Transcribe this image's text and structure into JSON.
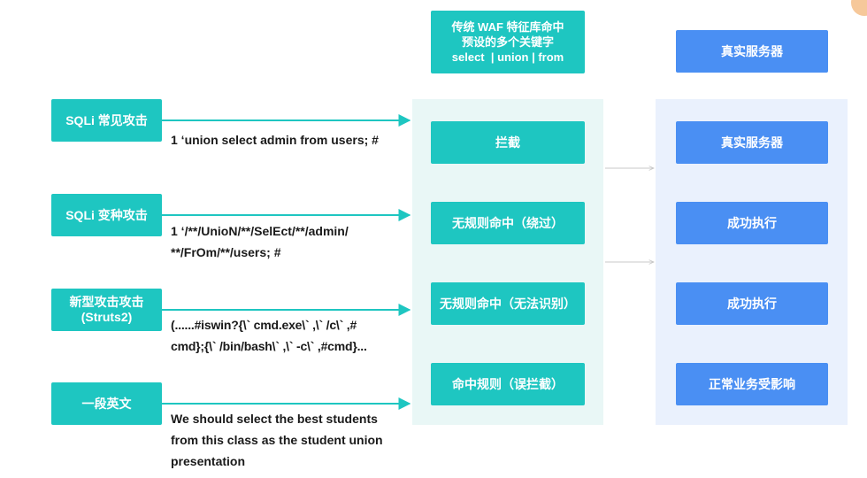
{
  "waf_header": {
    "line1": "传统 WAF 特征库命中",
    "line2": "预设的多个关键字",
    "line3": "select  | union | from"
  },
  "server_header": "真实服务器",
  "attacks": [
    {
      "label": "SQLi 常见攻击",
      "payload": "1  ‘union select admin from users; #"
    },
    {
      "label": "SQLi 变种攻击",
      "payload": "1  ‘/**/UnioN/**/SelEct/**/admin/\n**/FrOm/**/users; #"
    },
    {
      "label": "新型攻击攻击\n(Struts2)",
      "payload": "(......#iswin?{\\` cmd.exe\\` ,\\` /c\\` ,#\ncmd};{\\` /bin/bash\\` ,\\` -c\\` ,#cmd}..."
    },
    {
      "label": "一段英文",
      "payload": "We should select the best students\nfrom this class as the student union\npresentation"
    }
  ],
  "waf_results": [
    "拦截",
    "无规则命中（绕过）",
    "无规则命中（无法识别）",
    "命中规则（误拦截）"
  ],
  "server_results": [
    "真实服务器",
    "成功执行",
    "成功执行",
    "正常业务受影响"
  ],
  "colors": {
    "teal": "#1ec6c1",
    "blue": "#4a8ff3",
    "panel_waf": "#e9f7f6",
    "panel_server": "#eaf1fd",
    "arrow": "#1ec6c1",
    "connector": "#c8c8c8"
  }
}
